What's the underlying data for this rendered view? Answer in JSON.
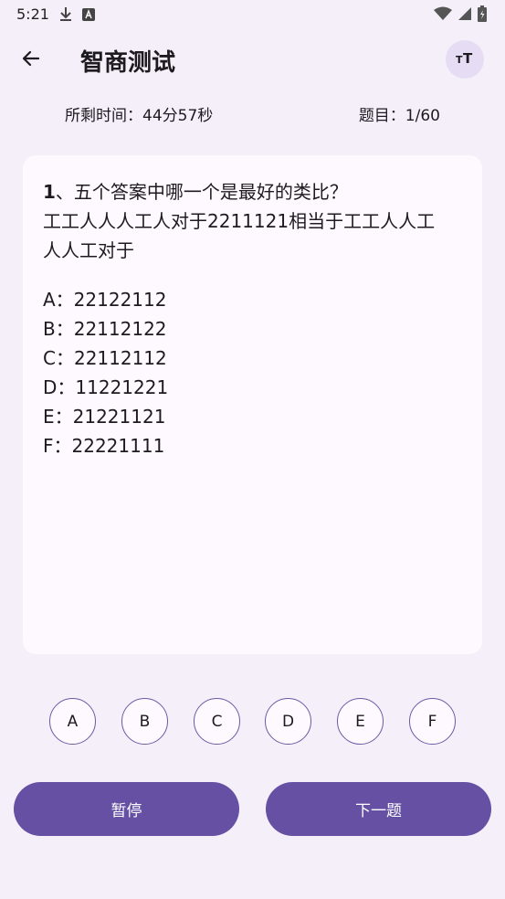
{
  "status_bar": {
    "time": "5:21",
    "left_icons": [
      "download-icon",
      "a-letter-icon"
    ],
    "right_icons": [
      "wifi-icon",
      "signal-icon",
      "battery-icon"
    ]
  },
  "app_bar": {
    "back_icon": "arrow-left-icon",
    "title": "智商测试",
    "font_size_icon": "font-size-icon"
  },
  "info": {
    "time_remaining": "所剩时间：44分57秒",
    "question_count": "题目：1/60"
  },
  "question": {
    "number": "1",
    "text_rest": "、五个答案中哪一个是最好的类比？",
    "body_line1": "工工人人人工人对于2211121相当于工工人人工",
    "body_line2": "人人工对于",
    "options": [
      "A：22122112",
      "B：22112122",
      "C：22112112",
      "D：11221221",
      "E：21221121",
      "F：22221111"
    ]
  },
  "answers": [
    "A",
    "B",
    "C",
    "D",
    "E",
    "F"
  ],
  "buttons": {
    "pause": "暂停",
    "next": "下一题"
  },
  "colors": {
    "background": "#f4eff9",
    "card": "#fdf9ff",
    "primary": "#6650a4",
    "font_button_bg": "#e6dcf3"
  }
}
